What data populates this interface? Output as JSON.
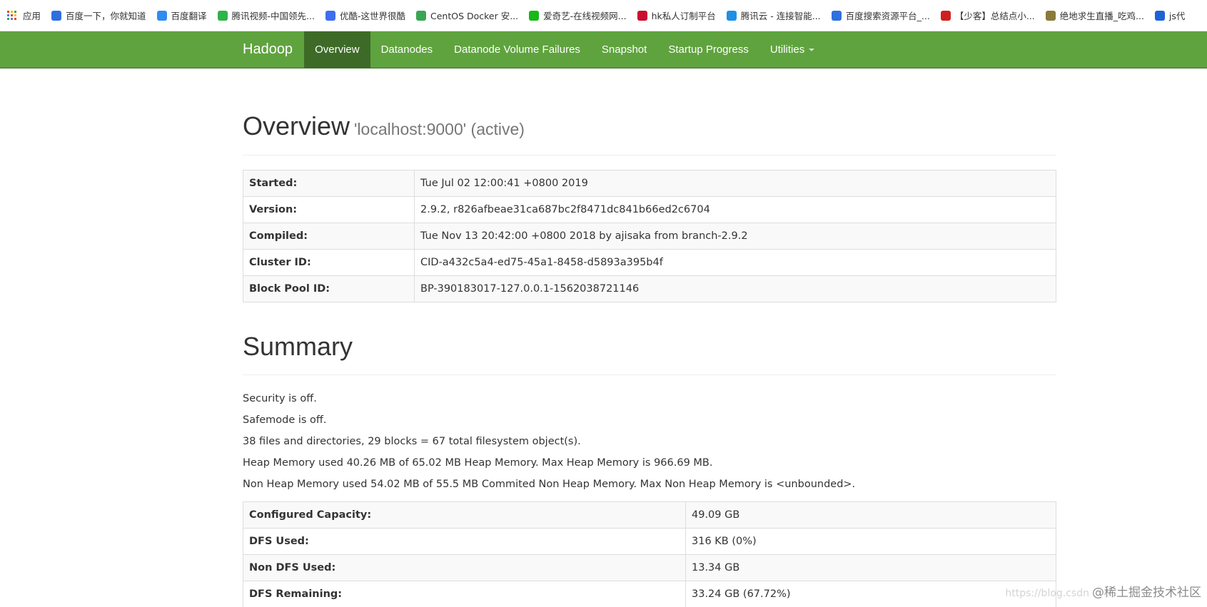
{
  "bookmarks": [
    {
      "label": "应用",
      "icon": "apps-grid-icon",
      "color": "#e0443a"
    },
    {
      "label": "百度一下，你就知道",
      "icon": "baidu-paw-icon",
      "color": "#2f6fe0"
    },
    {
      "label": "百度翻译",
      "icon": "baidu-translate-icon",
      "color": "#2f8cf0"
    },
    {
      "label": "腾讯视频-中国领先...",
      "icon": "tencent-video-icon",
      "color": "#2fb34a"
    },
    {
      "label": "优酷-这世界很酷",
      "icon": "youku-icon",
      "color": "#3d6ef0"
    },
    {
      "label": "CentOS Docker 安...",
      "icon": "docker-icon",
      "color": "#3aa654"
    },
    {
      "label": "爱奇艺-在线视频网...",
      "icon": "iqiyi-icon",
      "color": "#18b819"
    },
    {
      "label": "hk私人订制平台",
      "icon": "hk-platform-icon",
      "color": "#c8102e"
    },
    {
      "label": "腾讯云 - 连接智能...",
      "icon": "tencent-cloud-icon",
      "color": "#1e90e6"
    },
    {
      "label": "百度搜索资源平台_...",
      "icon": "baidu-paw-icon",
      "color": "#2f6fe0"
    },
    {
      "label": "【少客】总结点小...",
      "icon": "csdn-c-icon",
      "color": "#d01f1f"
    },
    {
      "label": "绝地求生直播_吃鸡...",
      "icon": "pubg-icon",
      "color": "#8a7a3a"
    },
    {
      "label": "js代",
      "icon": "js-icon",
      "color": "#1e63d6"
    }
  ],
  "navbar": {
    "brand": "Hadoop",
    "items": [
      "Overview",
      "Datanodes",
      "Datanode Volume Failures",
      "Snapshot",
      "Startup Progress",
      "Utilities"
    ],
    "active": "Overview"
  },
  "overview": {
    "title": "Overview",
    "subtitle": "'localhost:9000' (active)",
    "rows": [
      {
        "key": "Started:",
        "value": "Tue Jul 02 12:00:41 +0800 2019"
      },
      {
        "key": "Version:",
        "value": "2.9.2, r826afbeae31ca687bc2f8471dc841b66ed2c6704"
      },
      {
        "key": "Compiled:",
        "value": "Tue Nov 13 20:42:00 +0800 2018 by ajisaka from branch-2.9.2"
      },
      {
        "key": "Cluster ID:",
        "value": "CID-a432c5a4-ed75-45a1-8458-d5893a395b4f"
      },
      {
        "key": "Block Pool ID:",
        "value": "BP-390183017-127.0.0.1-1562038721146"
      }
    ]
  },
  "summary": {
    "title": "Summary",
    "lines": [
      "Security is off.",
      "Safemode is off.",
      "38 files and directories, 29 blocks = 67 total filesystem object(s).",
      "Heap Memory used 40.26 MB of 65.02 MB Heap Memory. Max Heap Memory is 966.69 MB.",
      "Non Heap Memory used 54.02 MB of 55.5 MB Commited Non Heap Memory. Max Non Heap Memory is <unbounded>."
    ],
    "rows": [
      {
        "key": "Configured Capacity:",
        "value": "49.09 GB"
      },
      {
        "key": "DFS Used:",
        "value": "316 KB (0%)"
      },
      {
        "key": "Non DFS Used:",
        "value": "13.34 GB"
      },
      {
        "key": "DFS Remaining:",
        "value": "33.24 GB (67.72%)"
      },
      {
        "key": "",
        "value": ""
      }
    ]
  },
  "watermark": {
    "url": "https://blog.csdn",
    "text": "@稀土掘金技术社区"
  }
}
